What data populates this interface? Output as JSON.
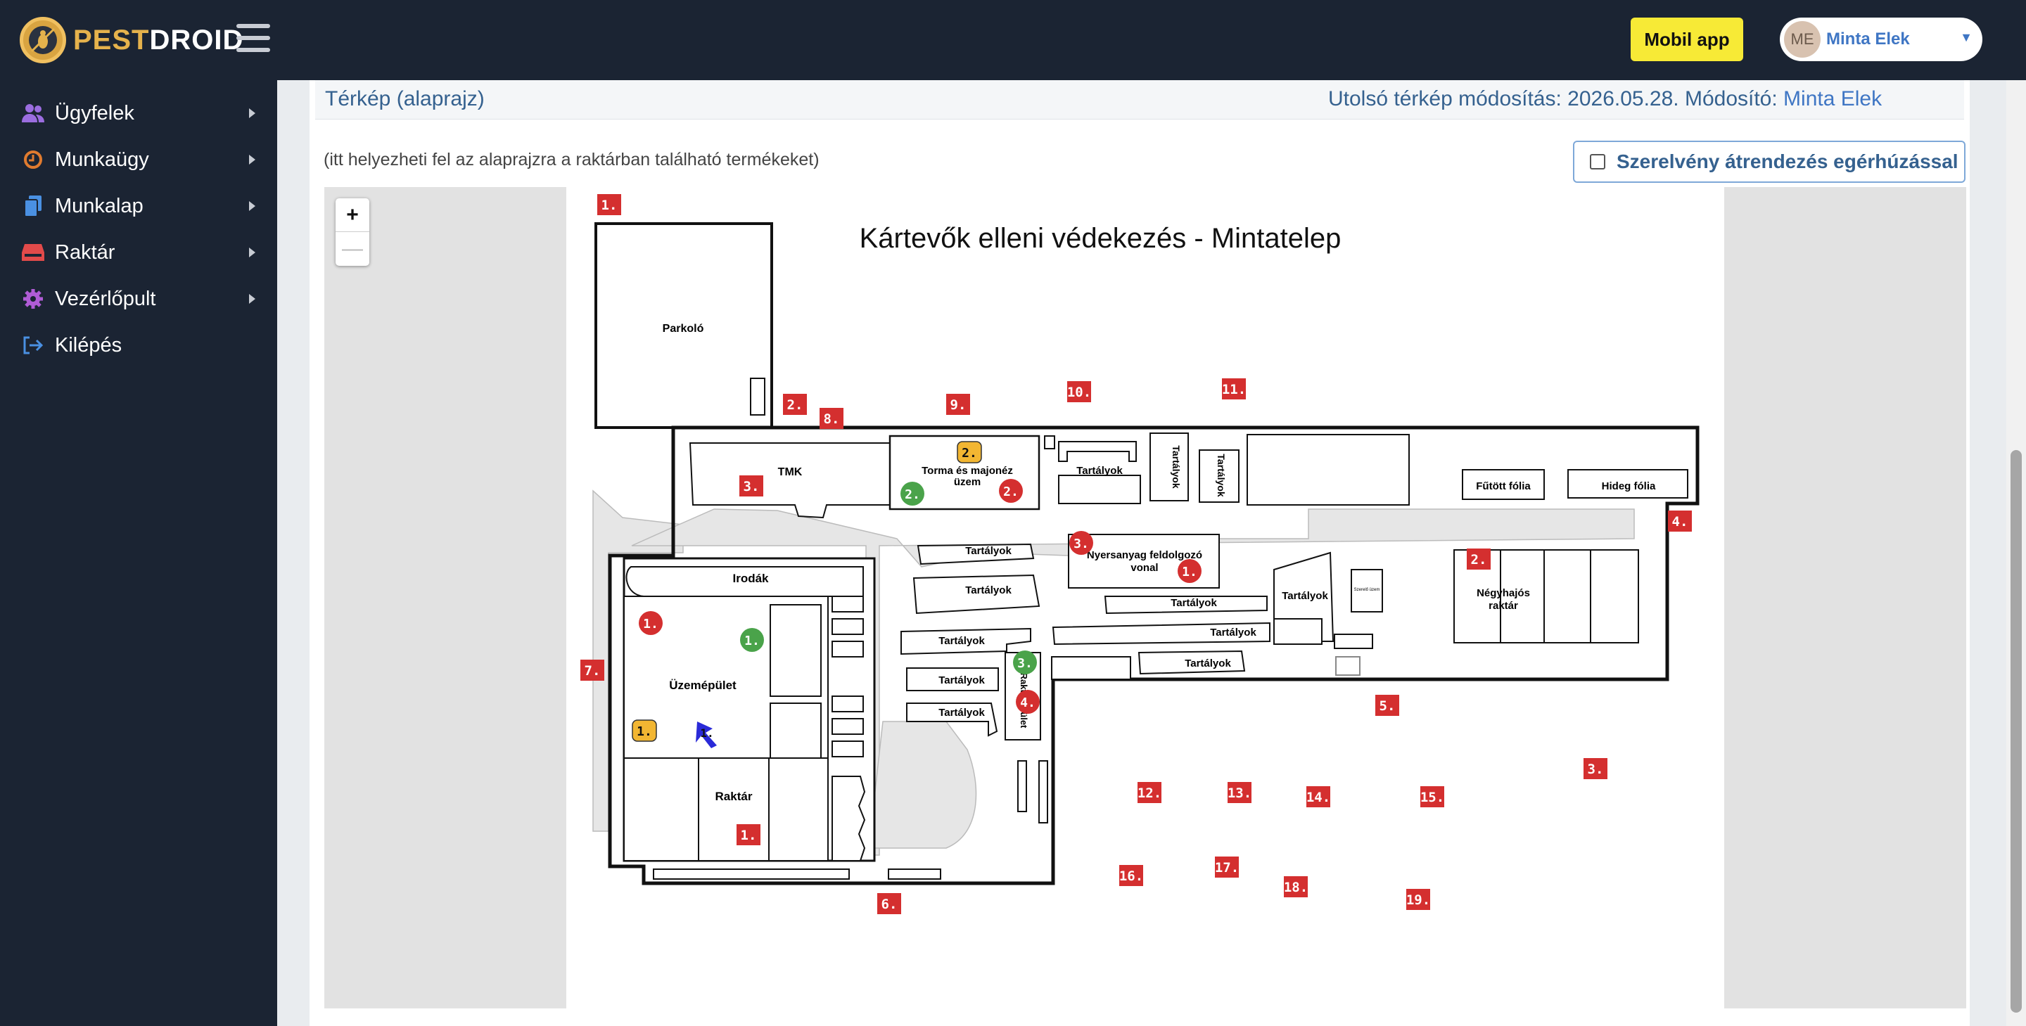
{
  "brand": {
    "pest": "PEST",
    "droid": "DROID"
  },
  "header": {
    "mobile_app": "Mobil app",
    "user_initials": "ME",
    "user_name": "Minta Elek"
  },
  "sidebar": {
    "items": [
      {
        "label": "Ügyfelek",
        "icon": "users-icon",
        "color": "#9b6de0"
      },
      {
        "label": "Munkaügy",
        "icon": "clock-icon",
        "color": "#e07b2f"
      },
      {
        "label": "Munkalap",
        "icon": "documents-icon",
        "color": "#4a90e2"
      },
      {
        "label": "Raktár",
        "icon": "warehouse-icon",
        "color": "#e24a4a"
      },
      {
        "label": "Vezérlőpult",
        "icon": "gear-icon",
        "color": "#b05cd6"
      },
      {
        "label": "Kilépés",
        "icon": "logout-icon",
        "color": "#4a90e2"
      }
    ]
  },
  "card": {
    "title": "Térkép (alaprajz)",
    "meta_prefix": "Utolsó térkép módosítás: 2026.05.28. Módosító:",
    "modifier": "Minta Elek",
    "hint": "(itt helyezheti fel az alaprajzra a raktárban található termékeket)",
    "drag_toggle_label": "Szerelvény átrendezés egérhúzással",
    "drag_toggle_checked": false
  },
  "map": {
    "title": "Kártevők elleni védekezés - Mintatelep",
    "zoom_in": "+",
    "zoom_out": "—",
    "rooms": {
      "parkolo": "Parkoló",
      "tmk": "TMK",
      "torma_1": "Torma és majonéz",
      "torma_2": "üzem",
      "irodak": "Irodák",
      "uzemepulet": "Üzemépület",
      "raktar": "Raktár",
      "tartalyok": "Tartályok",
      "nyersanyag_1": "Nyersanyag feldolgozó",
      "nyersanyag_2": "vonal",
      "futott_folia": "Fűtött fólia",
      "hideg_folia": "Hideg fólia",
      "negyhajos_1": "Négyhajós",
      "negyhajos_2": "raktár",
      "small_room": "Szerelő üzem",
      "vertical_room": "Raktárépület"
    },
    "markers_red_square": [
      "1.",
      "2.",
      "8.",
      "9.",
      "10.",
      "11.",
      "3.",
      "4.",
      "7.",
      "2.",
      "5.",
      "6.",
      "12.",
      "13.",
      "14.",
      "15.",
      "16.",
      "17.",
      "18.",
      "19.",
      "3.",
      "1."
    ],
    "markers_red_circle": [
      "2.",
      "3.",
      "1.",
      "1.",
      "4."
    ],
    "markers_green_circle": [
      "2.",
      "1.",
      "3."
    ],
    "markers_yellow": [
      "2.",
      "1."
    ],
    "markers_blue": [
      "1."
    ],
    "marker_colors": {
      "red": "#d42f2f",
      "green": "#4aa34a",
      "yellow": "#f2b632",
      "blue": "#2a2ad8"
    }
  }
}
